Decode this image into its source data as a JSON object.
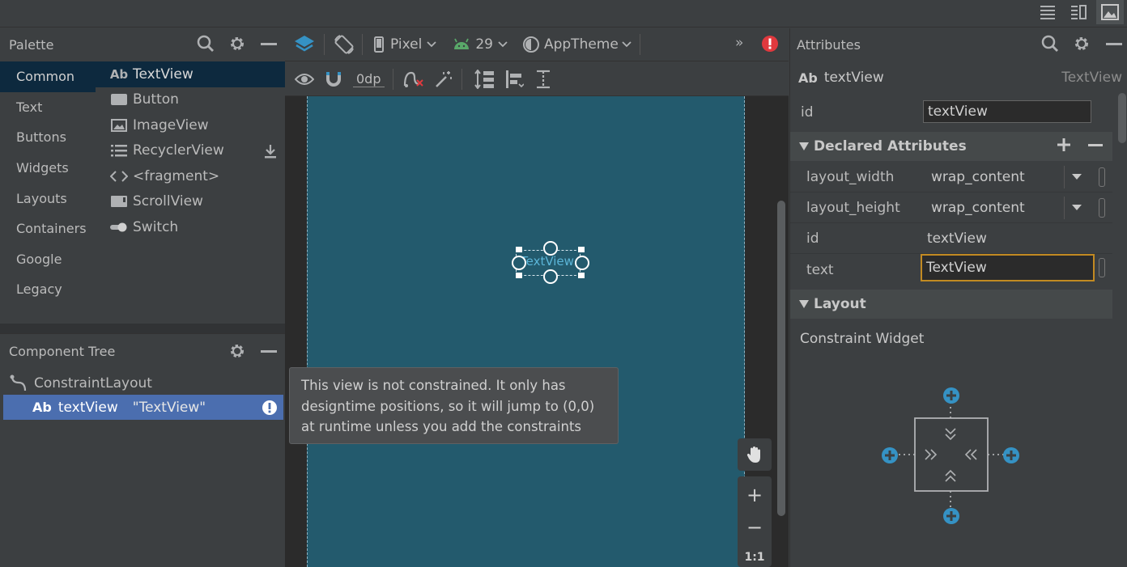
{
  "palette": {
    "title": "Palette",
    "categories": [
      "Common",
      "Text",
      "Buttons",
      "Widgets",
      "Layouts",
      "Containers",
      "Google",
      "Legacy"
    ],
    "items": [
      {
        "label": "TextView",
        "icon": "Ab"
      },
      {
        "label": "Button",
        "icon": "button-icon"
      },
      {
        "label": "ImageView",
        "icon": "image-icon"
      },
      {
        "label": "RecyclerView",
        "icon": "list-icon"
      },
      {
        "label": "<fragment>",
        "icon": "code-icon"
      },
      {
        "label": "ScrollView",
        "icon": "scroll-icon"
      },
      {
        "label": "Switch",
        "icon": "switch-icon"
      }
    ]
  },
  "tree": {
    "title": "Component Tree",
    "root_label": "ConstraintLayout",
    "child": {
      "icon": "Ab",
      "id": "textView",
      "text": "\"TextView\""
    }
  },
  "toolbar": {
    "device": "Pixel",
    "api": "29",
    "theme": "AppTheme",
    "margin": "0dp",
    "overflow": "»"
  },
  "canvas": {
    "widget_text": "TextView",
    "tooltip": "This view is not constrained. It only has designtime positions, so it will jump to (0,0) at runtime unless you add the constraints",
    "zoom_in": "+",
    "zoom_out": "−",
    "zoom_reset": "1:1"
  },
  "attributes": {
    "title": "Attributes",
    "widget_icon": "Ab",
    "widget_name": "textView",
    "widget_type": "TextView",
    "id_label": "id",
    "id_value": "textView",
    "declared_title": "Declared Attributes",
    "declared": [
      {
        "name": "layout_width",
        "value": "wrap_content",
        "dropdown": true
      },
      {
        "name": "layout_height",
        "value": "wrap_content",
        "dropdown": true
      },
      {
        "name": "id",
        "value": "textView",
        "dropdown": false
      },
      {
        "name": "text",
        "value": "TextView",
        "dropdown": false
      }
    ],
    "layout_title": "Layout",
    "layout_widget": "Constraint Widget"
  },
  "colors": {
    "selection": "#0d293e",
    "tree_selection": "#4b6eaf",
    "device": "#235a6d",
    "accent_add": "#3592c4",
    "error": "#e0393e",
    "focus": "#c28a22"
  }
}
